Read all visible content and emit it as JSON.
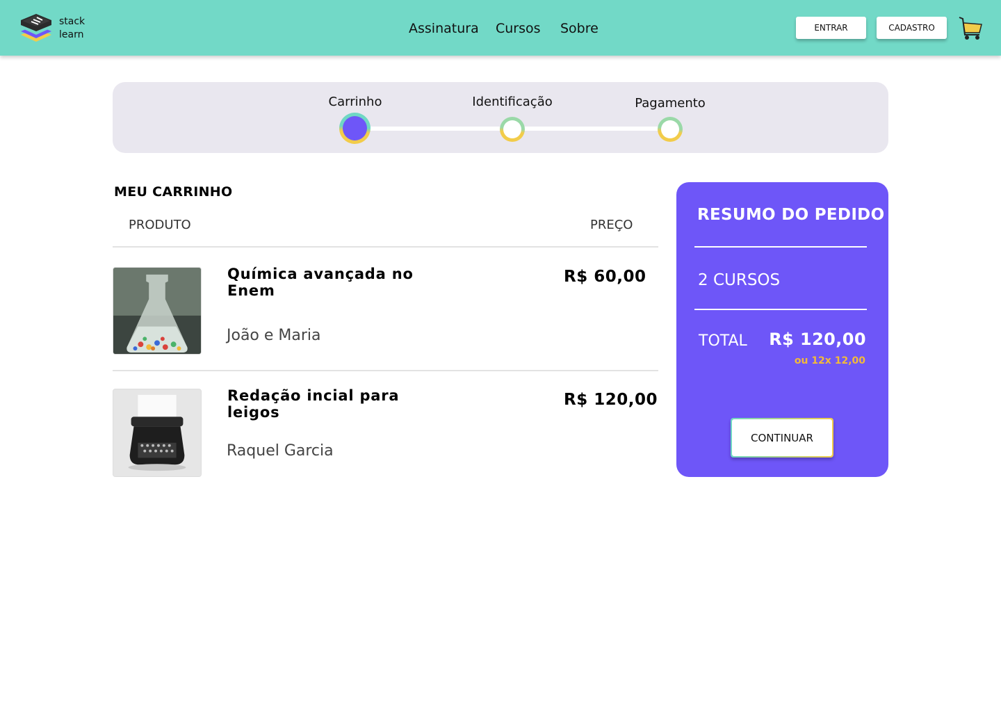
{
  "header": {
    "logo_line1": "stack",
    "logo_line2": "learn",
    "nav": [
      "Assinatura",
      "Cursos",
      "Sobre"
    ],
    "login_label": "ENTRAR",
    "signup_label": "CADASTRO",
    "cart_icon": "shopping-cart-icon"
  },
  "steps": {
    "items": [
      "Carrinho",
      "Identificação",
      "Pagamento"
    ],
    "active_index": 0
  },
  "cart": {
    "title": "MEU CARRINHO",
    "col_product": "PRODUTO",
    "col_price": "PREÇO",
    "items": [
      {
        "title": "Química avançada no Enem",
        "author": "João e Maria",
        "price": "R$ 60,00",
        "image": "flask-image"
      },
      {
        "title": "Redação incial para leigos",
        "author": "Raquel Garcia",
        "price": "R$ 120,00",
        "image": "typewriter-image"
      }
    ]
  },
  "summary": {
    "title": "RESUMO DO PEDIDO",
    "count": "2 CURSOS",
    "total_label": "TOTAL",
    "total_value": "R$ 120,00",
    "installments": "ou 12x 12,00",
    "continue_label": "CONTINUAR"
  },
  "colors": {
    "header": "#72d9c7",
    "accent": "#6e56f8",
    "installments": "#f2b93a",
    "steps_bg": "#e9e7ef"
  }
}
